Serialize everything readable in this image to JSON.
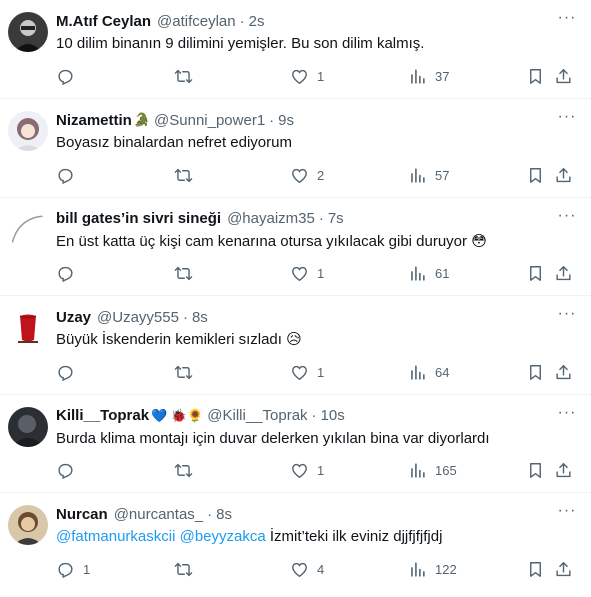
{
  "tweets": [
    {
      "name": "M.Atıf Ceylan",
      "name_emoji": "",
      "handle": "@atifceylan",
      "time": "2s",
      "text_parts": [
        {
          "t": "10 dilim binanın 9 dilimini yemişler. Bu son dilim kalmış.",
          "mention": false
        }
      ],
      "replies": "",
      "reposts": "",
      "likes": "1",
      "views": "37"
    },
    {
      "name": "Nizamettin",
      "name_emoji": "🐊",
      "handle": "@Sunni_power1",
      "time": "9s",
      "text_parts": [
        {
          "t": "Boyasız binalardan nefret ediyorum",
          "mention": false
        }
      ],
      "replies": "",
      "reposts": "",
      "likes": "2",
      "views": "57"
    },
    {
      "name": "bill gates’in sivri sineği",
      "name_emoji": "",
      "handle": "@hayaizm35",
      "time": "7s",
      "text_parts": [
        {
          "t": "En üst katta üç kişi cam kenarına otursa yıkılacak gibi duruyor 😳",
          "mention": false
        }
      ],
      "replies": "",
      "reposts": "",
      "likes": "1",
      "views": "61"
    },
    {
      "name": "Uzay",
      "name_emoji": "",
      "handle": "@Uzayy555",
      "time": "8s",
      "text_parts": [
        {
          "t": "Büyük İskenderin kemikleri sızladı 😥",
          "mention": false
        }
      ],
      "replies": "",
      "reposts": "",
      "likes": "1",
      "views": "64"
    },
    {
      "name": "Killi__Toprak",
      "name_emoji": "💙 🐞🌻",
      "handle": "@Killi__Toprak",
      "time": "10s",
      "text_parts": [
        {
          "t": "Burda klima montajı için duvar delerken yıkılan bina var diyorlardı",
          "mention": false
        }
      ],
      "replies": "",
      "reposts": "",
      "likes": "1",
      "views": "165"
    },
    {
      "name": "Nurcan",
      "name_emoji": "",
      "handle": "@nurcantas_",
      "time": "8s",
      "text_parts": [
        {
          "t": "@fatmanurkaskcii",
          "mention": true
        },
        {
          "t": " ",
          "mention": false
        },
        {
          "t": "@beyyzakca",
          "mention": true
        },
        {
          "t": " İzmit’teki ilk eviniz djjfjfjfjdj",
          "mention": false
        }
      ],
      "replies": "1",
      "reposts": "",
      "likes": "4",
      "views": "122"
    }
  ],
  "separator": "·",
  "colors": {
    "text": "#0f1419",
    "secondary": "#536471",
    "link": "#1d9bf0",
    "divider": "#eff3f4"
  },
  "icons": [
    "reply-icon",
    "repost-icon",
    "like-icon",
    "views-icon",
    "bookmark-icon",
    "share-icon",
    "more-icon"
  ]
}
